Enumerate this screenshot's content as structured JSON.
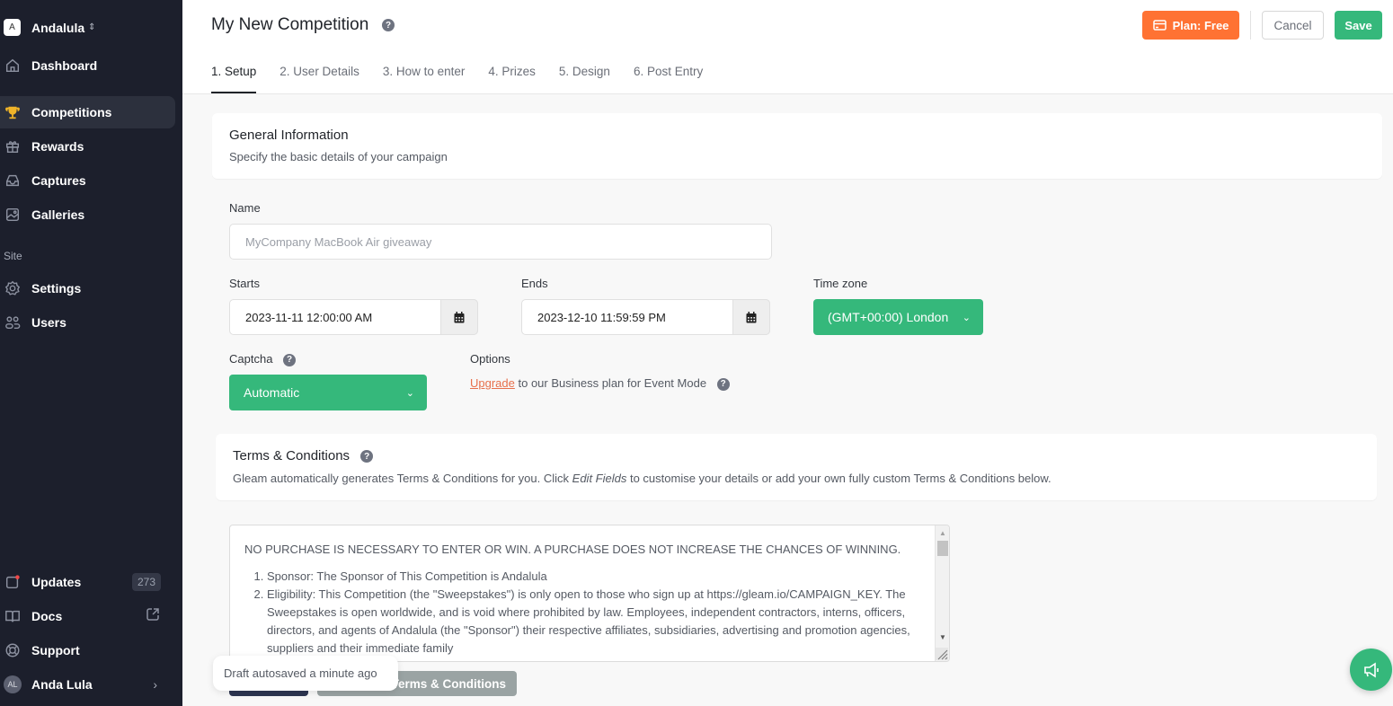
{
  "sidebar": {
    "brand_initial": "A",
    "brand_name": "Andalula",
    "items": [
      {
        "label": "Dashboard",
        "icon": "home-icon"
      },
      {
        "label": "Competitions",
        "icon": "trophy-icon",
        "active": true
      },
      {
        "label": "Rewards",
        "icon": "gift-icon"
      },
      {
        "label": "Captures",
        "icon": "inbox-icon"
      },
      {
        "label": "Galleries",
        "icon": "image-icon"
      }
    ],
    "section_site": "Site",
    "site_items": [
      {
        "label": "Settings",
        "icon": "gear-icon"
      },
      {
        "label": "Users",
        "icon": "users-icon"
      }
    ],
    "bottom_items": [
      {
        "label": "Updates",
        "icon": "notification-icon",
        "badge": "273"
      },
      {
        "label": "Docs",
        "icon": "book-icon"
      },
      {
        "label": "Support",
        "icon": "lifebuoy-icon"
      }
    ],
    "user": {
      "initials": "AL",
      "name": "Anda Lula"
    }
  },
  "header": {
    "title": "My New Competition",
    "help": "?",
    "tabs": [
      {
        "label": "1. Setup",
        "active": true
      },
      {
        "label": "2. User Details"
      },
      {
        "label": "3. How to enter"
      },
      {
        "label": "4. Prizes"
      },
      {
        "label": "5. Design"
      },
      {
        "label": "6. Post Entry"
      }
    ],
    "plan_label": "Plan: Free",
    "cancel_label": "Cancel",
    "save_label": "Save"
  },
  "general": {
    "title": "General Information",
    "subtitle": "Specify the basic details of your campaign",
    "name_label": "Name",
    "name_placeholder": "MyCompany MacBook Air giveaway",
    "starts_label": "Starts",
    "starts_value": "2023-11-11 12:00:00 AM",
    "ends_label": "Ends",
    "ends_value": "2023-12-10 11:59:59 PM",
    "timezone_label": "Time zone",
    "timezone_value": "(GMT+00:00) London",
    "captcha_label": "Captcha",
    "captcha_value": "Automatic",
    "options_label": "Options",
    "upgrade_link": "Upgrade",
    "options_text": " to our Business plan for Event Mode"
  },
  "terms": {
    "title": "Terms & Conditions",
    "desc_before": "Gleam automatically generates Terms & Conditions for you. Click ",
    "desc_em": "Edit Fields",
    "desc_after": " to customise your details or add your own fully custom Terms & Conditions below.",
    "intro": "NO PURCHASE IS NECESSARY TO ENTER OR WIN. A PURCHASE DOES NOT INCREASE THE CHANCES OF WINNING.",
    "items": [
      "Sponsor: The Sponsor of This Competition is Andalula",
      "Eligibility: This Competition (the \"Sweepstakes\") is only open to those who sign up at https://gleam.io/CAMPAIGN_KEY. The Sweepstakes is open worldwide, and is void where prohibited by law. Employees, independent contractors, interns, officers, directors, and agents of Andalula (the \"Sponsor\") their respective affiliates, subsidiaries, advertising and promotion agencies, suppliers and their immediate family"
    ],
    "custom_button": "Terms & Conditions"
  },
  "toast": "Draft autosaved a minute ago",
  "colors": {
    "sidebar_bg": "#1c1f2c",
    "accent_green": "#35b87b",
    "plan_orange": "#ff7233",
    "link_orange": "#e7704c",
    "trophy_gold": "#f0b429"
  }
}
